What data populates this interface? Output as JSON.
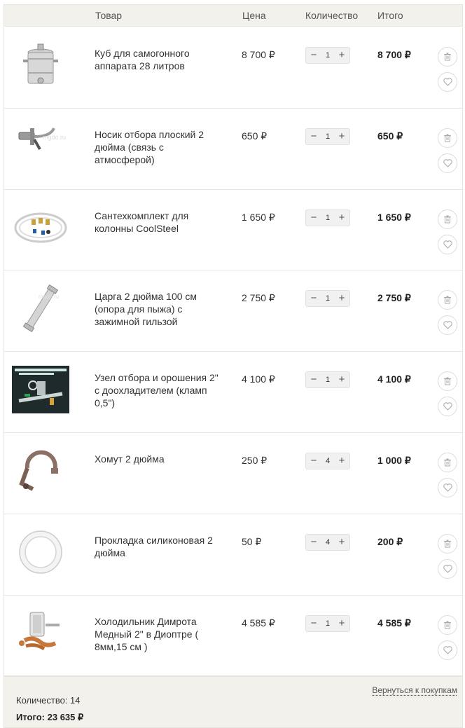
{
  "columns": {
    "product": "Товар",
    "price": "Цена",
    "quantity": "Количество",
    "total": "Итого"
  },
  "stepper": {
    "minus": "−",
    "plus": "+"
  },
  "items": [
    {
      "name": "Куб для самогонного аппарата 28 литров",
      "price": "8 700 ₽",
      "qty": "1",
      "total": "8 700 ₽",
      "image": "pot-still-image"
    },
    {
      "name": "Носик отбора плоский 2 дюйма (связь с атмосферой)",
      "price": "650 ₽",
      "qty": "1",
      "total": "650 ₽",
      "image": "nozzle-image"
    },
    {
      "name": "Сантехкомплект для колонны CoolSteel",
      "price": "1 650 ₽",
      "qty": "1",
      "total": "1 650 ₽",
      "image": "plumbing-kit-image"
    },
    {
      "name": "Царга 2 дюйма 100 см (опора для пыжа) с зажимной гильзой",
      "price": "2 750 ₽",
      "qty": "1",
      "total": "2 750 ₽",
      "image": "column-tube-image"
    },
    {
      "name": "Узел отбора и орошения 2\" с доохладителем (кламп 0,5\")",
      "price": "4 100 ₽",
      "qty": "1",
      "total": "4 100 ₽",
      "image": "reflux-node-image"
    },
    {
      "name": "Хомут 2 дюйма",
      "price": "250 ₽",
      "qty": "4",
      "total": "1 000 ₽",
      "image": "clamp-image"
    },
    {
      "name": "Прокладка силиконовая 2 дюйма",
      "price": "50 ₽",
      "qty": "4",
      "total": "200 ₽",
      "image": "gasket-image"
    },
    {
      "name": "Холодильник Димрота Медный 2\" в Диоптре ( 8мм,15 см )",
      "price": "4 585 ₽",
      "qty": "1",
      "total": "4 585 ₽",
      "image": "dimroth-cooler-image"
    }
  ],
  "footer": {
    "back_link": "Вернуться к покупкам",
    "count_text": "Количество: 14",
    "total_label": "Итого:",
    "total_value": "23 635 ₽"
  },
  "colors": {
    "header_bg": "#f3f1ec",
    "text": "#333333",
    "border": "#e4e4e4"
  }
}
